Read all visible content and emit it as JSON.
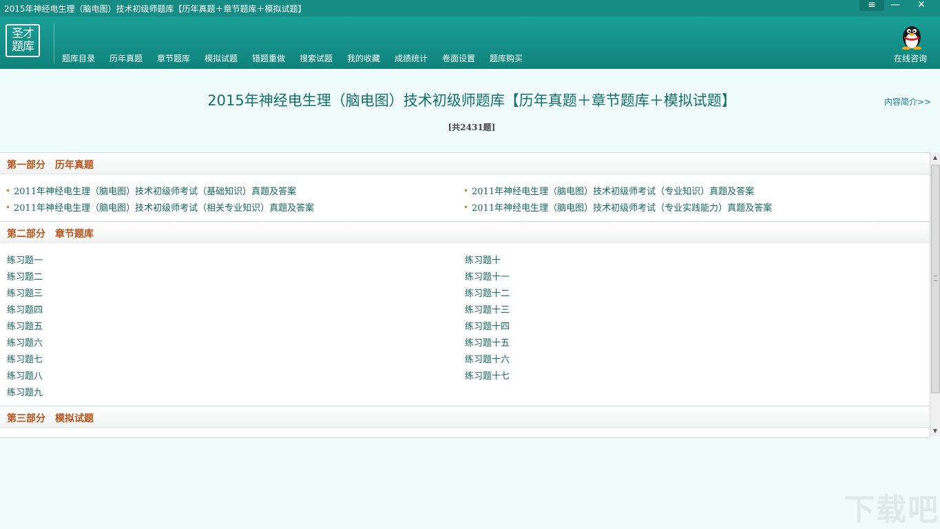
{
  "window": {
    "title": "2015年神经电生理（脑电图）技术初级师题库【历年真题＋章节题库＋模拟试题】",
    "menu_glyph": "≡",
    "minimize_glyph": "—",
    "close_glyph": "✕"
  },
  "header": {
    "logo_line1": "圣才",
    "logo_line2": "题库",
    "nav": [
      "题库目录",
      "历年真题",
      "章节题库",
      "模拟试题",
      "错题重做",
      "搜索试题",
      "我的收藏",
      "成绩统计",
      "卷面设置",
      "题库购买"
    ],
    "consult_label": "在线咨询"
  },
  "page": {
    "title": "2015年神经电生理（脑电图）技术初级师题库【历年真题＋章节题库＋模拟试题】",
    "count": "[共2431题]",
    "intro_link": "内容简介>>"
  },
  "sections": [
    {
      "label": "第一部分　历年真题",
      "items_left": [
        "2011年神经电生理（脑电图）技术初级师考试（基础知识）真题及答案",
        "2011年神经电生理（脑电图）技术初级师考试（相关专业知识）真题及答案"
      ],
      "items_right": [
        "2011年神经电生理（脑电图）技术初级师考试（专业知识）真题及答案",
        "2011年神经电生理（脑电图）技术初级师考试（专业实践能力）真题及答案"
      ]
    },
    {
      "label": "第二部分　章节题库",
      "items_left": [
        "练习题一",
        "练习题二",
        "练习题三",
        "练习题四",
        "练习题五",
        "练习题六",
        "练习题七",
        "练习题八",
        "练习题九"
      ],
      "items_right": [
        "练习题十",
        "练习题十一",
        "练习题十二",
        "练习题十三",
        "练习题十四",
        "练习题十五",
        "练习题十六",
        "练习题十七"
      ]
    },
    {
      "label": "第三部分　模拟试题"
    }
  ],
  "watermark": "下载吧",
  "colors": {
    "header": "#168c85",
    "section_label": "#b8531a",
    "link": "#16665f",
    "bullet": "#e07b2a",
    "background": "#f0fcfb"
  }
}
